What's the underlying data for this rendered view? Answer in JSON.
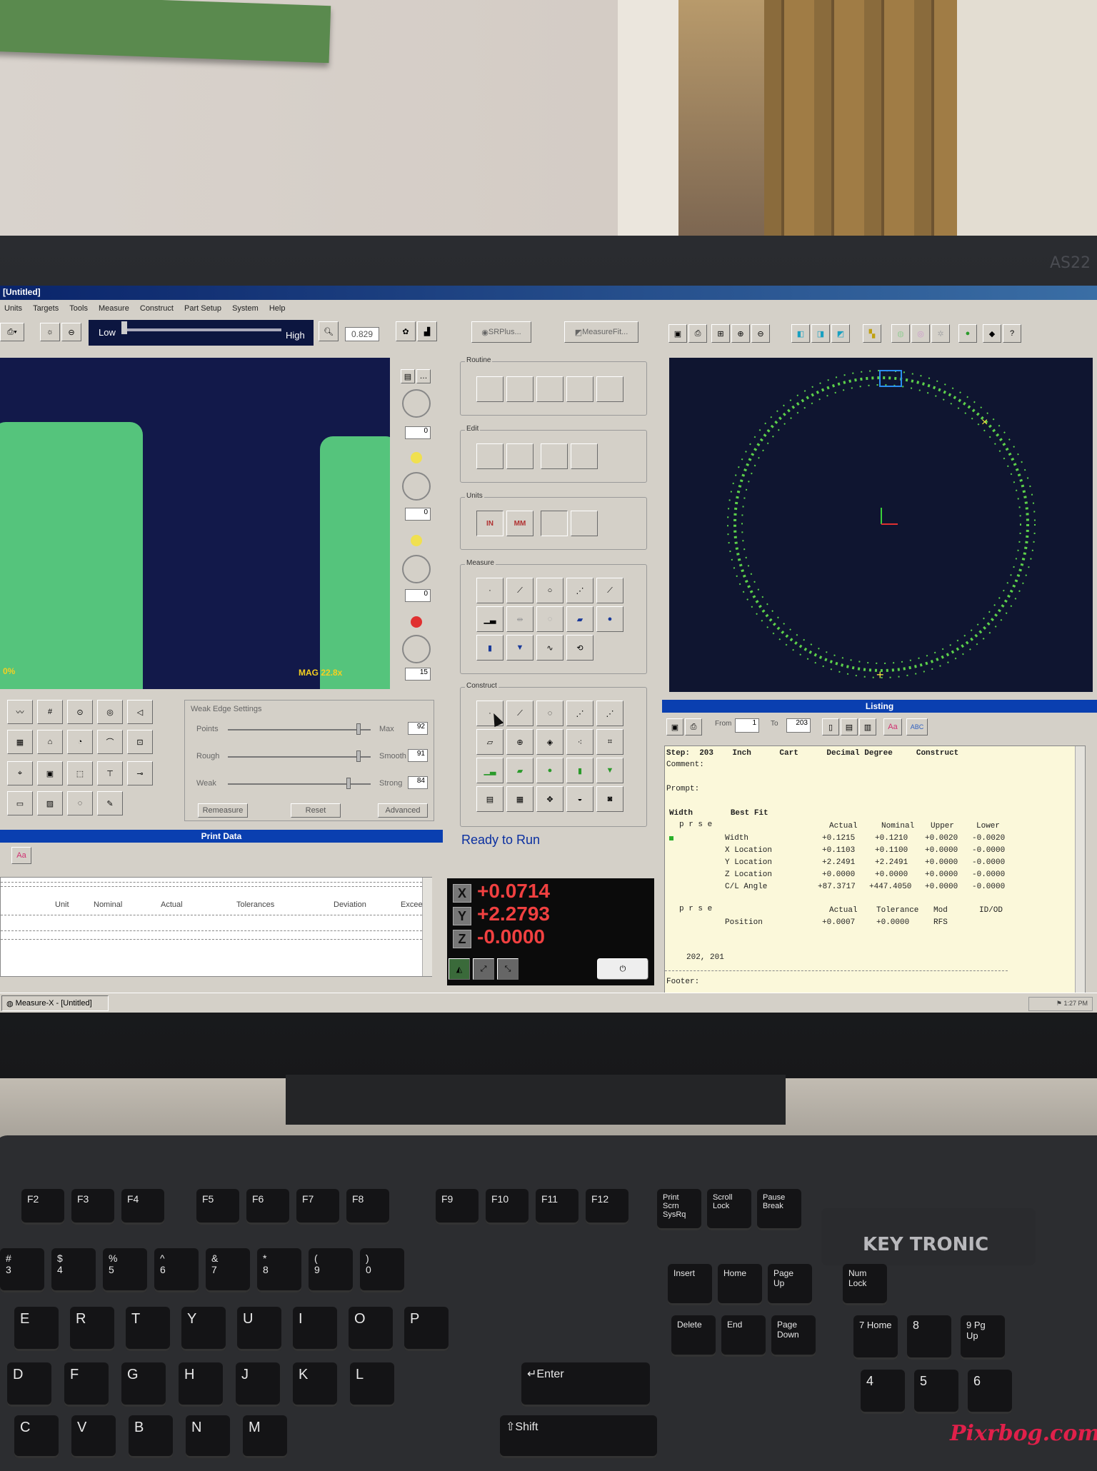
{
  "window": {
    "title": "[Untitled]"
  },
  "menu": [
    "Units",
    "Targets",
    "Tools",
    "Measure",
    "Construct",
    "Part Setup",
    "System",
    "Help"
  ],
  "video": {
    "light_low": "Low",
    "light_high": "High",
    "zoom_value": "0.829",
    "overlay_left": "0%",
    "overlay_mag": "MAG 22.8x",
    "side_values": [
      "0",
      "0",
      "0",
      "15"
    ]
  },
  "weak_edge": {
    "title": "Weak Edge Settings",
    "rows": [
      {
        "left": "Points",
        "right": "Max",
        "value": "92"
      },
      {
        "left": "Rough",
        "right": "Smooth",
        "value": "91"
      },
      {
        "left": "Weak",
        "right": "Strong",
        "value": "84"
      }
    ],
    "buttons": [
      "Remeasure",
      "Reset",
      "Advanced"
    ]
  },
  "print_data": {
    "title": "Print Data",
    "aa": "Aa",
    "columns": [
      "Unit",
      "Nominal",
      "Actual",
      "Tolerances",
      "Deviation",
      "Exceed"
    ]
  },
  "middle": {
    "top_buttons": [
      "SRPlus...",
      "MeasureFit..."
    ],
    "groups": [
      "Routine",
      "Edit",
      "Units",
      "Measure",
      "Construct"
    ],
    "units_in": "IN",
    "units_mm": "MM",
    "status": "Ready to Run"
  },
  "dro": {
    "x_label": "X",
    "x": "+0.0714",
    "y_label": "Y",
    "y": "+2.2793",
    "z_label": "Z",
    "z": "-0.0000"
  },
  "listing": {
    "title": "Listing",
    "from_label": "From",
    "from_value": "1",
    "to_label": "To",
    "to_value": "203",
    "aa": "Aa",
    "abc": "ABC",
    "step_line": "Step:  203    Inch      Cart      Decimal Degree     Construct",
    "comment": "Comment:",
    "prompt": "Prompt:",
    "feature": "Width        Best Fit",
    "prse": "p r s e",
    "headers": [
      "Actual",
      "Nominal",
      "Upper",
      "Lower"
    ],
    "rows": [
      {
        "name": "Width",
        "actual": "+0.1215",
        "nominal": "+0.1210",
        "upper": "+0.0020",
        "lower": "-0.0020"
      },
      {
        "name": "X Location",
        "actual": "+0.1103",
        "nominal": "+0.1100",
        "upper": "+0.0000",
        "lower": "-0.0000"
      },
      {
        "name": "Y Location",
        "actual": "+2.2491",
        "nominal": "+2.2491",
        "upper": "+0.0000",
        "lower": "-0.0000"
      },
      {
        "name": "Z Location",
        "actual": "+0.0000",
        "nominal": "+0.0000",
        "upper": "+0.0000",
        "lower": "-0.0000"
      },
      {
        "name": "C/L Angle",
        "actual": "+87.3717",
        "nominal": "+447.4050",
        "upper": "+0.0000",
        "lower": "-0.0000"
      }
    ],
    "prse2": "p r s e",
    "headers2": [
      "Actual",
      "Tolerance",
      "Mod",
      "ID/OD"
    ],
    "position": {
      "name": "Position",
      "actual": "+0.0007",
      "tolerance": "+0.0000",
      "mod": "RFS"
    },
    "refs": "202, 201",
    "footer": "Footer:"
  },
  "taskbar": {
    "app": "Measure-X - [Untitled]",
    "clock": "1:27 PM"
  },
  "monitor": {
    "brand": "AS22"
  },
  "keyboard": {
    "brand": "KEY TRONIC",
    "fkeys": [
      "F2",
      "F3",
      "F4",
      "F5",
      "F6",
      "F7",
      "F8",
      "F9",
      "F10",
      "F11",
      "F12"
    ],
    "special": [
      "Print Scrn SysRq",
      "Scroll Lock",
      "Pause Break"
    ],
    "nav1": [
      "Insert",
      "Home",
      "Page Up"
    ],
    "nav2": [
      "Delete",
      "End",
      "Page Down"
    ],
    "numrow": [
      "#\n3",
      "$\n4",
      "%\n5",
      "^\n6",
      "&\n7",
      "*\n8",
      "(\n9",
      ")\n0"
    ],
    "letters1": [
      "E",
      "R",
      "T",
      "Y",
      "U",
      "I",
      "O",
      "P"
    ],
    "letters2": [
      "D",
      "F",
      "G",
      "H",
      "J",
      "K",
      "L"
    ],
    "letters3": [
      "C",
      "V",
      "B",
      "N",
      "M"
    ],
    "enter": "Enter",
    "shift": "Shift",
    "numpad": [
      "Num Lock",
      "7 Home",
      "8",
      "9 Pg Up",
      "4",
      "5",
      "6"
    ]
  },
  "watermark": "Pixrbog.com",
  "colors": {
    "title_bar": "#0a246a",
    "listing_bg": "#fbf8da",
    "dro_text": "#f04040",
    "circle": "#5cd04a",
    "part_green": "#55c47c"
  }
}
